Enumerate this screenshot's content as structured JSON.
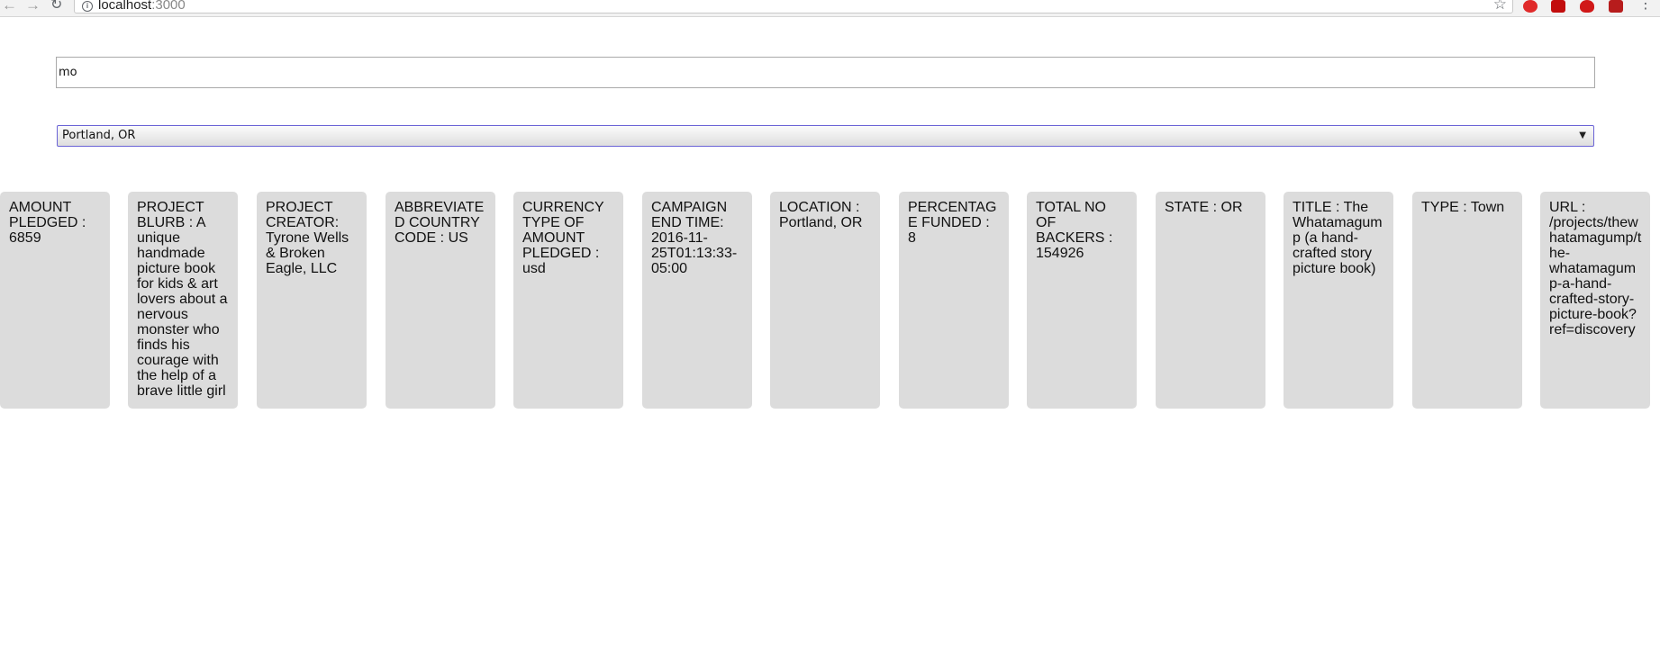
{
  "browser": {
    "url_host": "localhost",
    "url_port": ":3000"
  },
  "search": {
    "value": "mo"
  },
  "location_select": {
    "selected": "Portland, OR"
  },
  "cards": [
    {
      "label": "AMOUNT PLEDGED",
      "sep": " : ",
      "value": "6859"
    },
    {
      "label": "PROJECT BLURB",
      "sep": " : ",
      "value": "A unique handmade picture book for kids & art lovers about a nervous monster who finds his courage with the help of a brave little girl"
    },
    {
      "label": "PROJECT CREATOR",
      "sep": ": ",
      "value": "Tyrone Wells & Broken Eagle, LLC"
    },
    {
      "label": "ABBREVIATED COUNTRY CODE",
      "sep": " : ",
      "value": "US"
    },
    {
      "label": "CURRENCY TYPE OF AMOUNT PLEDGED",
      "sep": " : ",
      "value": "usd"
    },
    {
      "label": "CAMPAIGN END TIME",
      "sep": ": ",
      "value": "2016-11-25T01:13:33-05:00"
    },
    {
      "label": "LOCATION",
      "sep": " : ",
      "value": "Portland, OR"
    },
    {
      "label": "PERCENTAGE FUNDED",
      "sep": " : ",
      "value": "8"
    },
    {
      "label": "TOTAL NO OF BACKERS",
      "sep": " : ",
      "value": "154926"
    },
    {
      "label": "STATE",
      "sep": " : ",
      "value": "OR"
    },
    {
      "label": "TITLE",
      "sep": " : ",
      "value": "The Whatamagump (a hand-crafted story picture book)"
    },
    {
      "label": "TYPE",
      "sep": " : ",
      "value": "Town"
    },
    {
      "label": "URL",
      "sep": " : ",
      "value": "/projects/thewhatamagump/the-whatamagump-a-hand-crafted-story-picture-book?ref=discovery"
    }
  ]
}
